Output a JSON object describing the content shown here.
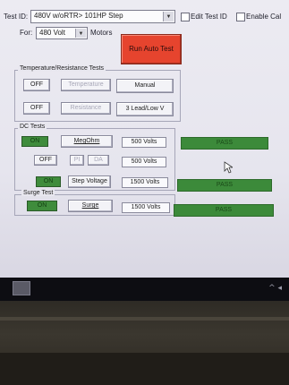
{
  "header": {
    "test_id_label": "Test ID:",
    "test_id_value": "480V w/oRTR> 101HP Step",
    "edit_test_id_label": "Edit Test ID",
    "enable_cal_label": "Enable Cal",
    "for_label": "For:",
    "for_value": "480 Volt",
    "motors_label": "Motors",
    "run_auto_test_label": "Run Auto Test"
  },
  "temperature_group": {
    "title": "Temperature/Resistance Tests",
    "row1": {
      "off_label": "OFF",
      "test_label": "Temperature",
      "mode_label": "Manual"
    },
    "row2": {
      "off_label": "OFF",
      "test_label": "Resistance",
      "mode_label": "3 Lead/Low V"
    }
  },
  "dc_group": {
    "title": "DC Tests",
    "rows": [
      {
        "toggle_label": "ON",
        "test_label": "MegOhm",
        "volts": "500 Volts",
        "result": "PASS"
      },
      {
        "toggle_label": "OFF",
        "test_label": "PI",
        "test_label_2": "DA",
        "volts": "500 Volts"
      },
      {
        "toggle_label": "ON",
        "test_label": "Step Voltage",
        "volts": "1500 Volts",
        "result": "PASS"
      }
    ]
  },
  "surge_group": {
    "title": "Surge Test",
    "toggle_label": "ON",
    "test_label": "Surge",
    "volts": "1500 Volts",
    "result": "PASS"
  },
  "taskbar": {
    "tray_text": "^ ◂"
  },
  "colors": {
    "pass_green": "#3c8a3a",
    "run_red": "#e6442e",
    "window_bg": "#ecebf2"
  }
}
